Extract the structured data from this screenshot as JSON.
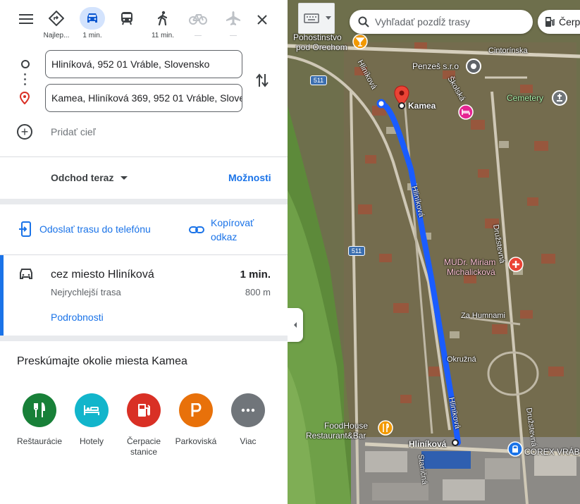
{
  "modes": [
    {
      "label": "Najlep...",
      "icon": "route-diamond-icon",
      "name": "mode-best"
    },
    {
      "label": "1 min.",
      "icon": "car-icon",
      "name": "mode-driving",
      "active": true
    },
    {
      "label": "",
      "icon": "transit-icon",
      "name": "mode-transit"
    },
    {
      "label": "11 min.",
      "icon": "walk-icon",
      "name": "mode-walking"
    },
    {
      "label": "—",
      "icon": "bicycle-icon",
      "name": "mode-cycling"
    },
    {
      "label": "—",
      "icon": "plane-icon",
      "name": "mode-flight"
    }
  ],
  "waypoints": {
    "start": "Hliníková, 952 01 Vráble, Slovensko",
    "destination": "Kamea, Hliníková 369, 952 01 Vráble, Slovensko",
    "add_label": "Pridať cieľ"
  },
  "departure": {
    "label": "Odchod teraz",
    "options_label": "Možnosti"
  },
  "share": {
    "send_label": "Odoslať trasu do telefónu",
    "copy_label": "Kopírovať odkaz"
  },
  "route": {
    "via": "cez miesto Hliníková",
    "time": "1 min.",
    "subtitle": "Nejrychlejší trasa",
    "distance": "800 m",
    "details_label": "Podrobnosti"
  },
  "explore": {
    "title": "Preskúmajte okolie miesta Kamea",
    "categories": [
      {
        "label": "Reštaurácie",
        "color": "#188038",
        "icon": "restaurant-icon"
      },
      {
        "label": "Hotely",
        "color": "#12b5cb",
        "icon": "hotel-icon"
      },
      {
        "label": "Čerpacie stanice",
        "color": "#d93025",
        "icon": "gas-station-icon"
      },
      {
        "label": "Parkoviská",
        "color": "#e8710a",
        "icon": "parking-icon"
      },
      {
        "label": "Viac",
        "color": "#5f6368",
        "icon": "more-icon"
      }
    ]
  },
  "map": {
    "search_placeholder": "Vyhľadať pozdĺž trasy",
    "chip_label": "Čerpa",
    "labels": {
      "pohostinstvo": "Pohostinstvo",
      "pod_orechom": "pod Orechom",
      "penzes": "Penzeš s.r.o",
      "cemetery": "Cemetery",
      "kamea": "Kamea",
      "mudr1": "MUDr. Miriam",
      "mudr2": "Michalicková",
      "food1": "FoodHouse",
      "food2": "Restaurant&Bar",
      "hlinikova_end": "Hliníková",
      "corex": "COREX VRÁB"
    },
    "streets": {
      "cintorinska": "Cintorínska",
      "hlinikova1": "Hliníková",
      "hlinikova2": "Hliníková",
      "hlinikova3": "Hliníková",
      "druzstevna": "Družstevná",
      "druzstevna2": "Družstevná",
      "za_humnami": "Za Humnami",
      "okruzna": "Okružná",
      "skolska": "Školská",
      "stanicna": "Staničná"
    },
    "road_shields": [
      "511",
      "511"
    ],
    "route_color": "#1a5cff"
  }
}
